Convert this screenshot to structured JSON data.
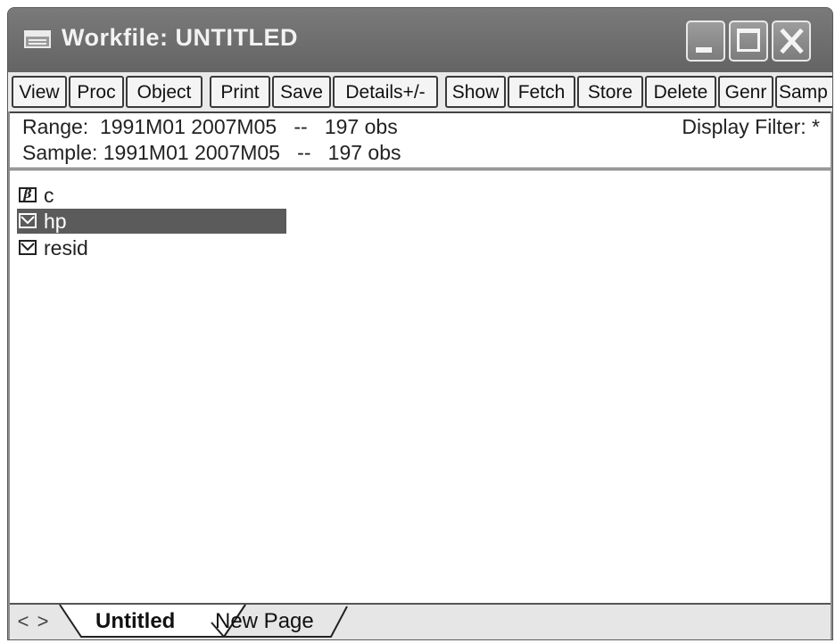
{
  "window": {
    "title": "Workfile: UNTITLED"
  },
  "toolbar": {
    "buttons": [
      "View",
      "Proc",
      "Object",
      "Print",
      "Save",
      "Details+/-",
      "Show",
      "Fetch",
      "Store",
      "Delete",
      "Genr",
      "Samp"
    ]
  },
  "info": {
    "range_label": "Range:",
    "range_value": "1991M01 2007M05",
    "range_sep": "--",
    "range_obs": "197 obs",
    "sample_label": "Sample:",
    "sample_value": "1991M01 2007M05",
    "sample_sep": "--",
    "sample_obs": "197 obs",
    "filter_label": "Display Filter:",
    "filter_value": "*"
  },
  "objects": [
    {
      "name": "c",
      "icon": "coefficient-icon",
      "selected": false
    },
    {
      "name": "hp",
      "icon": "series-icon",
      "selected": true
    },
    {
      "name": "resid",
      "icon": "series-icon",
      "selected": false
    }
  ],
  "tabs": {
    "scroll_left": "<",
    "scroll_right": ">",
    "active": "Untitled",
    "other": "New Page"
  },
  "colors": {
    "titlebar": "#6e6e6e",
    "selection": "#5b5b5b"
  }
}
